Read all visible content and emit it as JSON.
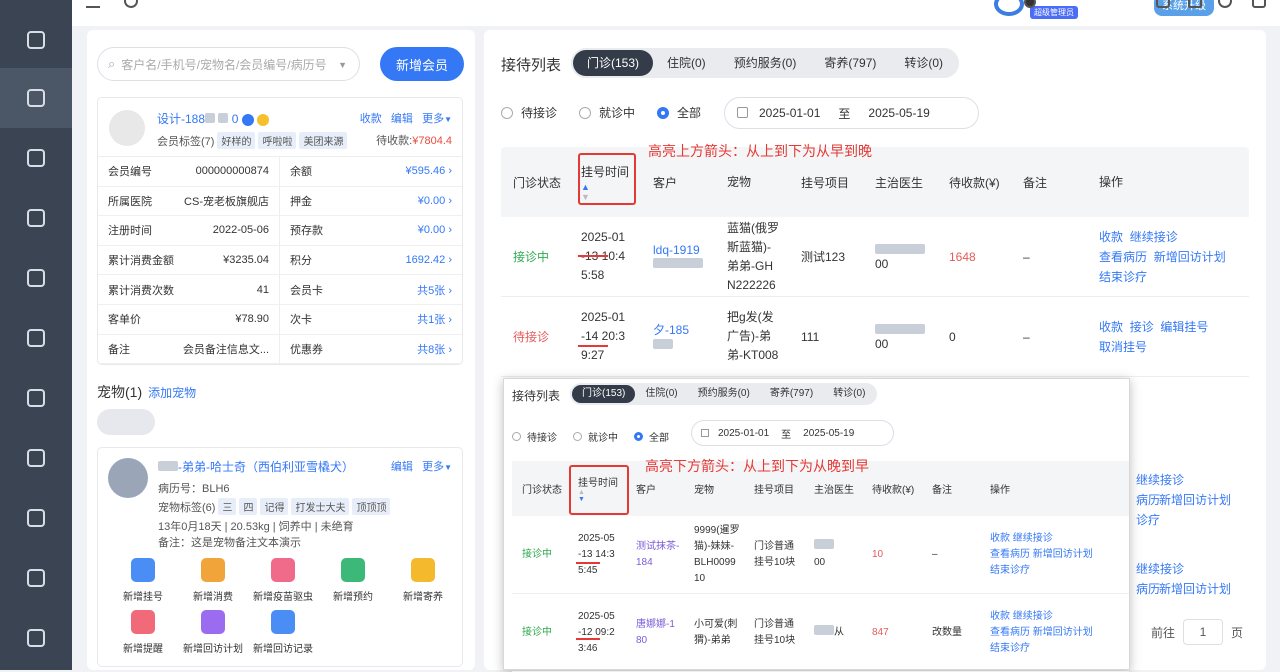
{
  "topbar": {
    "admin_badge": "超级管理员",
    "upgrade": "系统升级"
  },
  "search": {
    "placeholder": "客户名/手机号/宠物名/会员编号/病历号",
    "new_member": "新增会员"
  },
  "member": {
    "name": "设计-188",
    "name_suffix": "0",
    "actions": [
      "收款",
      "编辑",
      "更多"
    ],
    "tags_label": "会员标签(7)",
    "tags": [
      "好样的",
      "呼啦啦",
      "美团来源"
    ],
    "owe_label": "待收款:",
    "owe_value": "¥7804.4",
    "rows": [
      {
        "l": "会员编号",
        "lv": "000000000874",
        "r": "余额",
        "rv": "¥595.46"
      },
      {
        "l": "所属医院",
        "lv": "CS-宠老板旗舰店",
        "r": "押金",
        "rv": "¥0.00"
      },
      {
        "l": "注册时间",
        "lv": "2022-05-06",
        "r": "预存款",
        "rv": "¥0.00"
      },
      {
        "l": "累计消费金额",
        "lv": "¥3235.04",
        "r": "积分",
        "rv": "1692.42"
      },
      {
        "l": "累计消费次数",
        "lv": "41",
        "r": "会员卡",
        "rv": "共5张"
      },
      {
        "l": "客单价",
        "lv": "¥78.90",
        "r": "次卡",
        "rv": "共1张"
      },
      {
        "l": "备注",
        "lv": "会员备注信息文...",
        "r": "优惠券",
        "rv": "共8张"
      }
    ]
  },
  "pets": {
    "title": "宠物(1)",
    "add": "添加宠物",
    "name": "-弟弟-哈士奇（西伯利亚雪橇犬）",
    "actions": [
      "编辑",
      "更多"
    ],
    "record": "病历号：BLH6",
    "tags_label": "宠物标签(6)",
    "tags": [
      "三",
      "四",
      "记得",
      "打发士大夫",
      "顶顶顶"
    ],
    "info": "13年0月18天 | 20.53kg | 饲养中 | 未绝育",
    "note": "备注：这是宠物备注文本演示",
    "quick": [
      {
        "label": "新增挂号",
        "color": "#4a8ef5"
      },
      {
        "label": "新增消费",
        "color": "#f0a43a"
      },
      {
        "label": "新增疫苗驱虫",
        "color": "#f06a8a"
      },
      {
        "label": "新增预约",
        "color": "#3cb878"
      },
      {
        "label": "新增寄养",
        "color": "#f5b92e"
      },
      {
        "label": "新增提醒",
        "color": "#f06a7a"
      },
      {
        "label": "新增回访计划",
        "color": "#9b6cf0"
      },
      {
        "label": "新增回访记录",
        "color": "#4a8ef5"
      }
    ]
  },
  "reception": {
    "title": "接待列表",
    "tabs": [
      "门诊(153)",
      "住院(0)",
      "预约服务(0)",
      "寄养(797)",
      "转诊(0)"
    ],
    "filters": [
      "待接诊",
      "就诊中",
      "全部"
    ],
    "date_from": "2025-01-01",
    "date_to_label": "至",
    "date_to": "2025-05-19",
    "headers": [
      "门诊状态",
      "挂号时间",
      "客户",
      "宠物",
      "挂号项目",
      "主治医生",
      "待收款(¥)",
      "备注",
      "操作"
    ],
    "rows": [
      {
        "status": "接诊中",
        "time": [
          "2025-01",
          "-13 10:4",
          "5:58"
        ],
        "customer": "ldq-1919",
        "pet": [
          "蓝猫(俄罗",
          "斯蓝猫)-",
          "弟弟-GH",
          "N222226"
        ],
        "item": "测试123",
        "doctor": "00",
        "owe": "1648",
        "note": "–",
        "ops": [
          "收款",
          "继续接诊",
          "查看病历",
          "新增回访计划",
          "结束诊疗"
        ]
      },
      {
        "status": "待接诊",
        "time": [
          "2025-01",
          "-14 20:3",
          "9:27"
        ],
        "customer": "夕-185",
        "pet": [
          "把g发(发",
          "广告)-弟",
          "弟-KT008"
        ],
        "item": "111",
        "doctor": "00",
        "owe": "0",
        "note": "–",
        "ops": [
          "收款",
          "接诊",
          "编辑挂号",
          "取消挂号"
        ]
      }
    ],
    "partial_ops": [
      "继续接诊",
      "病历",
      "新增回访计划",
      "诊疗"
    ],
    "pager": {
      "prev_label": "前往",
      "page": "1",
      "unit": "页"
    }
  },
  "annotations": {
    "top": "高亮上方箭头：从上到下为从早到晚",
    "bottom": "高亮下方箭头：从上到下为从晚到早"
  },
  "overlay": {
    "rows": [
      {
        "status": "接诊中",
        "time": [
          "2025-05",
          "-13 14:3",
          "5:45"
        ],
        "customer": [
          "测试抹茶-",
          "184"
        ],
        "pet": [
          "9999(暹罗",
          "猫)-妹妹-",
          "BLH0099",
          "10"
        ],
        "item": [
          "门诊普通",
          "挂号10块"
        ],
        "doctor": "00",
        "owe": "10",
        "note": "–",
        "ops": [
          "收款",
          "继续接诊",
          "查看病历",
          "新增回访计划",
          "结束诊疗"
        ]
      },
      {
        "status": "接诊中",
        "time": [
          "2025-05",
          "-12 09:2",
          "3:46"
        ],
        "customer": [
          "唐娜娜-1",
          "80"
        ],
        "pet": [
          "小可爱(刺",
          "猬)-弟弟"
        ],
        "item": [
          "门诊普通",
          "挂号10块"
        ],
        "doctor": "从",
        "owe": "847",
        "note": "改数量",
        "ops": [
          "收款",
          "继续接诊",
          "查看病历",
          "新增回访计划",
          "结束诊疗"
        ]
      }
    ]
  }
}
